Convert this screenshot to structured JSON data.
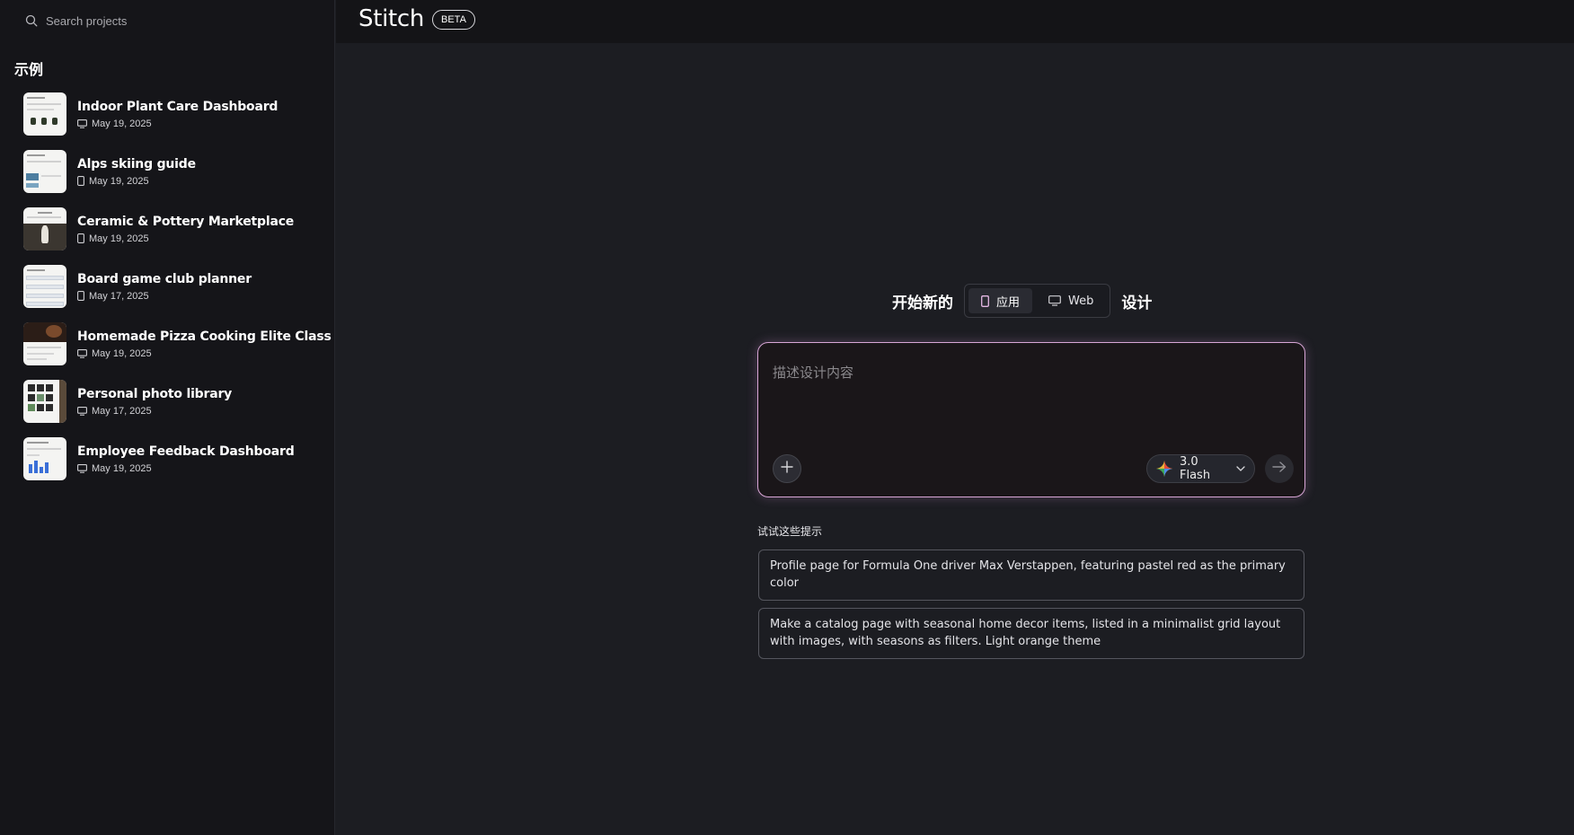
{
  "sidebar": {
    "search": {
      "placeholder": "Search projects"
    },
    "section_title": "示例",
    "projects": [
      {
        "title": "Indoor Plant Care Dashboard",
        "date": "May 19, 2025",
        "device": "desktop-icon"
      },
      {
        "title": "Alps skiing guide",
        "date": "May 19, 2025",
        "device": "mobile-icon"
      },
      {
        "title": "Ceramic & Pottery Marketplace",
        "date": "May 19, 2025",
        "device": "mobile-icon"
      },
      {
        "title": "Board game club planner",
        "date": "May 17, 2025",
        "device": "mobile-icon"
      },
      {
        "title": "Homemade Pizza Cooking Elite Class",
        "date": "May 19, 2025",
        "device": "desktop-icon"
      },
      {
        "title": "Personal photo library",
        "date": "May 17, 2025",
        "device": "desktop-icon"
      },
      {
        "title": "Employee Feedback Dashboard",
        "date": "May 19, 2025",
        "device": "desktop-icon"
      }
    ]
  },
  "header": {
    "brand": "Stitch",
    "badge": "BETA"
  },
  "main": {
    "start_prefix": "开始新的",
    "start_suffix": "设计",
    "segments": [
      {
        "label": "应用",
        "icon": "mobile-icon",
        "active": true
      },
      {
        "label": "Web",
        "icon": "desktop-icon",
        "active": false
      }
    ],
    "composer": {
      "placeholder": "描述设计内容",
      "model_label": "3.0 Flash"
    },
    "hints_title": "试试这些提示",
    "hints": [
      "Profile page for Formula One driver Max Verstappen, featuring pastel red as the primary color",
      "Make a catalog page with seasonal home decor items, listed in a minimalist grid layout with images, with seasons as filters. Light orange theme"
    ]
  },
  "colors": {
    "background": "#1c1d22",
    "sidebar": "#151519",
    "header": "#141417",
    "composer_border": "#d8a6d6",
    "text": "#ffffff"
  }
}
